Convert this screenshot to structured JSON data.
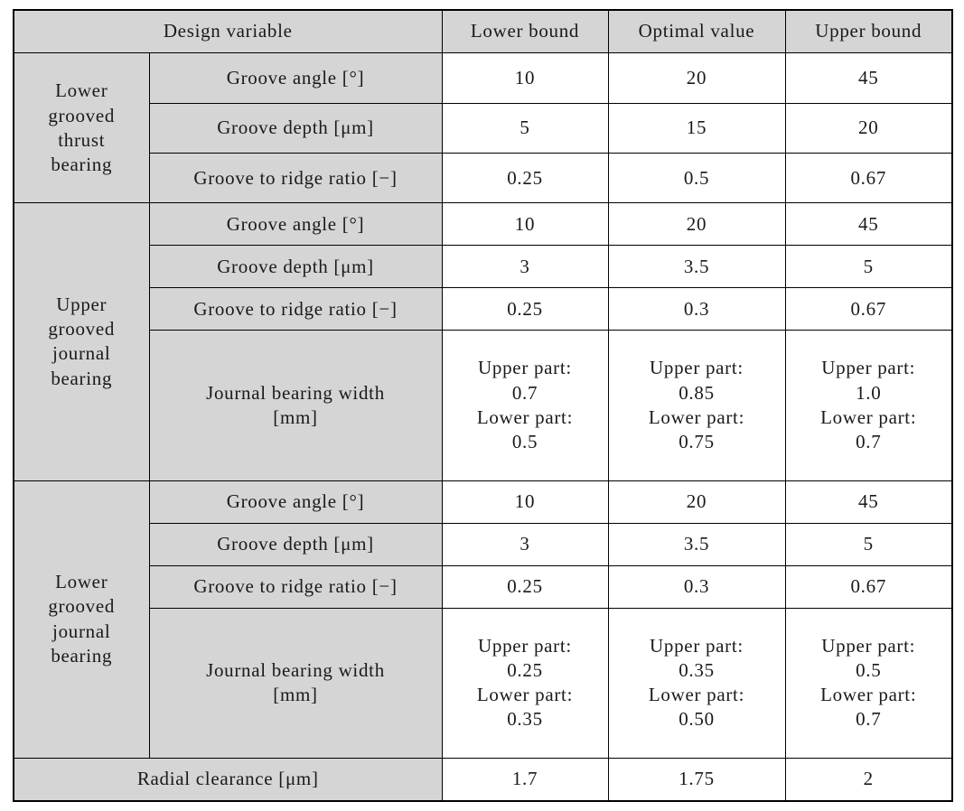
{
  "table": {
    "header": {
      "design_variable": "Design variable",
      "lower_bound": "Lower bound",
      "optimal_value": "Optimal value",
      "upper_bound": "Upper bound"
    },
    "groups": [
      {
        "name": "Lower grooved thrust bearing",
        "rows": [
          {
            "variable": "Groove angle [°]",
            "lower": "10",
            "optimal": "20",
            "upper": "45"
          },
          {
            "variable": "Groove depth [μm]",
            "lower": "5",
            "optimal": "15",
            "upper": "20"
          },
          {
            "variable": "Groove to ridge ratio [−]",
            "lower": "0.25",
            "optimal": "0.5",
            "upper": "0.67"
          }
        ]
      },
      {
        "name": "Upper grooved journal bearing",
        "rows": [
          {
            "variable": "Groove angle [°]",
            "lower": "10",
            "optimal": "20",
            "upper": "45"
          },
          {
            "variable": "Groove depth [μm]",
            "lower": "3",
            "optimal": "3.5",
            "upper": "5"
          },
          {
            "variable": "Groove to ridge ratio [−]",
            "lower": "0.25",
            "optimal": "0.3",
            "upper": "0.67"
          },
          {
            "variable_line1": "Journal bearing width",
            "variable_line2": "[mm]",
            "lower_upper_label": "Upper part:",
            "lower_upper_value": "0.7",
            "lower_lower_label": "Lower part:",
            "lower_lower_value": "0.5",
            "optimal_upper_label": "Upper part:",
            "optimal_upper_value": "0.85",
            "optimal_lower_label": "Lower part:",
            "optimal_lower_value": "0.75",
            "upper_upper_label": "Upper part:",
            "upper_upper_value": "1.0",
            "upper_lower_label": "Lower part:",
            "upper_lower_value": "0.7"
          }
        ]
      },
      {
        "name": "Lower grooved journal bearing",
        "rows": [
          {
            "variable": "Groove angle [°]",
            "lower": "10",
            "optimal": "20",
            "upper": "45"
          },
          {
            "variable": "Groove depth [μm]",
            "lower": "3",
            "optimal": "3.5",
            "upper": "5"
          },
          {
            "variable": "Groove to ridge ratio [−]",
            "lower": "0.25",
            "optimal": "0.3",
            "upper": "0.67"
          },
          {
            "variable_line1": "Journal bearing width",
            "variable_line2": "[mm]",
            "lower_upper_label": "Upper part:",
            "lower_upper_value": "0.25",
            "lower_lower_label": "Lower part:",
            "lower_lower_value": "0.35",
            "optimal_upper_label": "Upper part:",
            "optimal_upper_value": "0.35",
            "optimal_lower_label": "Lower part:",
            "optimal_lower_value": "0.50",
            "upper_upper_label": "Upper part:",
            "upper_upper_value": "0.5",
            "upper_lower_label": "Lower part:",
            "upper_lower_value": "0.7"
          }
        ]
      }
    ],
    "footer_row": {
      "variable": "Radial clearance [μm]",
      "lower": "1.7",
      "optimal": "1.75",
      "upper": "2"
    },
    "group_names": {
      "g1_l1": "Lower",
      "g1_l2": "grooved",
      "g1_l3": "thrust",
      "g1_l4": "bearing",
      "g2_l1": "Upper",
      "g2_l2": "grooved",
      "g2_l3": "journal",
      "g2_l4": "bearing",
      "g3_l1": "Lower",
      "g3_l2": "grooved",
      "g3_l3": "journal",
      "g3_l4": "bearing"
    },
    "colors": {
      "shade": "#d5d5d5",
      "border": "#000000",
      "text": "#1a1a1a",
      "background": "#ffffff"
    }
  }
}
